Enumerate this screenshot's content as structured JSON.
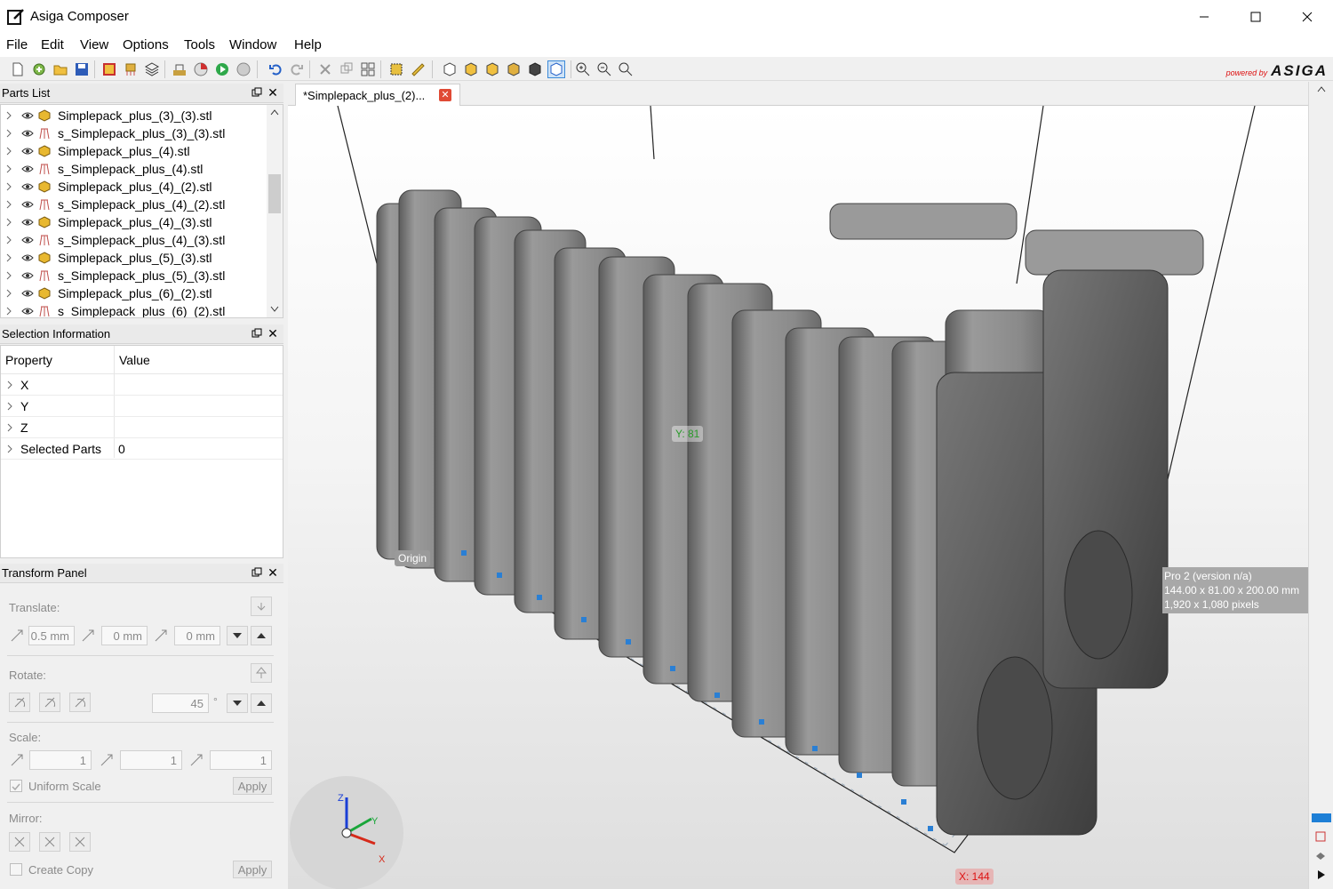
{
  "window": {
    "title": "Asiga Composer"
  },
  "menu": [
    "File",
    "Edit",
    "View",
    "Options",
    "Tools",
    "Window",
    "Help"
  ],
  "toolbar": {
    "brand_powered": "powered by",
    "brand_name": "ASIGA"
  },
  "parts_list": {
    "title": "Parts List",
    "items": [
      {
        "name": "Simplepack_plus_(3)_(3).stl",
        "kind": "part"
      },
      {
        "name": "s_Simplepack_plus_(3)_(3).stl",
        "kind": "support"
      },
      {
        "name": "Simplepack_plus_(4).stl",
        "kind": "part"
      },
      {
        "name": "s_Simplepack_plus_(4).stl",
        "kind": "support"
      },
      {
        "name": "Simplepack_plus_(4)_(2).stl",
        "kind": "part"
      },
      {
        "name": "s_Simplepack_plus_(4)_(2).stl",
        "kind": "support"
      },
      {
        "name": "Simplepack_plus_(4)_(3).stl",
        "kind": "part"
      },
      {
        "name": "s_Simplepack_plus_(4)_(3).stl",
        "kind": "support"
      },
      {
        "name": "Simplepack_plus_(5)_(3).stl",
        "kind": "part"
      },
      {
        "name": "s_Simplepack_plus_(5)_(3).stl",
        "kind": "support"
      },
      {
        "name": "Simplepack_plus_(6)_(2).stl",
        "kind": "part"
      },
      {
        "name": "s_Simplepack_plus_(6)_(2).stl",
        "kind": "support"
      }
    ]
  },
  "selection_info": {
    "title": "Selection Information",
    "col_property": "Property",
    "col_value": "Value",
    "rows": [
      {
        "key": "X",
        "value": ""
      },
      {
        "key": "Y",
        "value": ""
      },
      {
        "key": "Z",
        "value": ""
      },
      {
        "key": "Selected Parts",
        "value": "0"
      }
    ]
  },
  "transform": {
    "title": "Transform Panel",
    "translate_label": "Translate:",
    "translate_x": "0.5 mm",
    "translate_y": "0 mm",
    "translate_z": "0 mm",
    "rotate_label": "Rotate:",
    "rotate_value": "45",
    "rotate_unit": "°",
    "scale_label": "Scale:",
    "scale_x": "1",
    "scale_y": "1",
    "scale_z": "1",
    "uniform_scale": "Uniform Scale",
    "apply": "Apply",
    "mirror_label": "Mirror:",
    "create_copy": "Create Copy"
  },
  "document_tab": {
    "label": "*Simplepack_plus_(2)..."
  },
  "viewport": {
    "y_label": "Y: 81",
    "x_label": "X: 144",
    "origin_label": "Origin",
    "printer_info": [
      "Pro 2 (version n/a)",
      "144.00 x 81.00 x 200.00 mm",
      "1,920 x 1,080 pixels"
    ],
    "axis_labels": {
      "z": "Z",
      "y": "Y",
      "x": "X"
    }
  },
  "colors": {
    "accent": "#1e7fd6",
    "part_gray": "#8c8c8c",
    "tab_close": "#e04a35",
    "support_blue": "#2a7fd4"
  }
}
